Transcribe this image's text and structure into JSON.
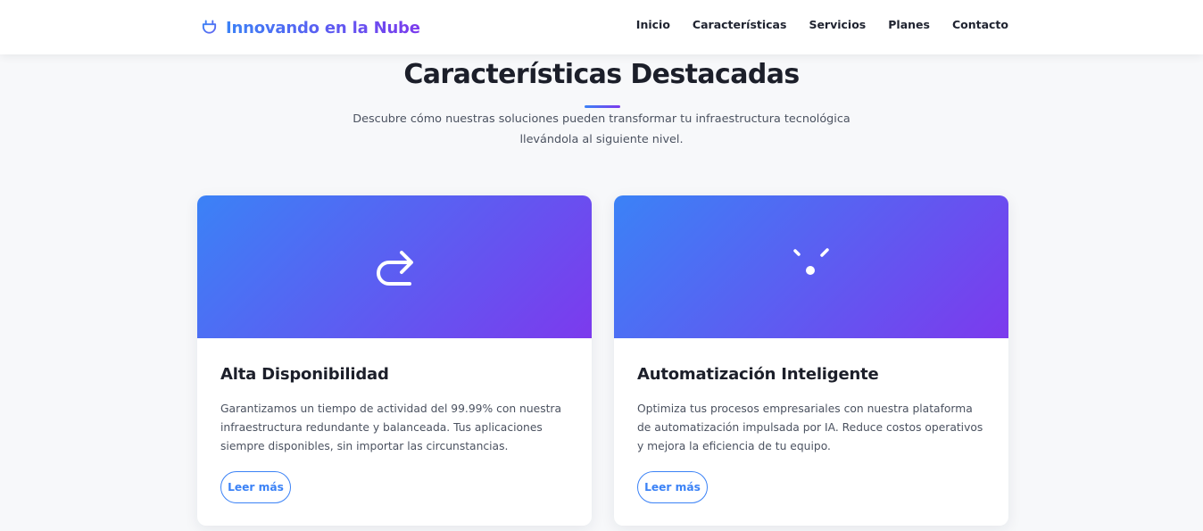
{
  "header": {
    "brand": "Innovando en la Nube",
    "brand_icon": "plug-icon",
    "nav": [
      "Inicio",
      "Características",
      "Servicios",
      "Planes",
      "Contacto"
    ]
  },
  "section": {
    "title": "Características Destacadas",
    "subtitle_line1": "Descubre cómo nuestras soluciones pueden transformar tu infraestructura tecnológica",
    "subtitle_line2": "llevándola al siguiente nivel."
  },
  "cards": [
    {
      "icon": "redo-arrow-icon",
      "title": "Alta Disponibilidad",
      "text": "Garantizamos un tiempo de actividad del 99.99% con nuestra infraestructura redundante y balanceada. Tus aplicaciones siempre disponibles, sin importar las circunstancias.",
      "button": "Leer más"
    },
    {
      "icon": "spark-icon",
      "title": "Automatización Inteligente",
      "text": "Optimiza tus procesos empresariales con nuestra plataforma de automatización impulsada por IA. Reduce costos operativos y mejora la eficiencia de tu equipo.",
      "button": "Leer más"
    }
  ],
  "colors": {
    "accent_start": "#3b82f6",
    "accent_end": "#7c3aed",
    "page_background": "#f7f8fa"
  }
}
